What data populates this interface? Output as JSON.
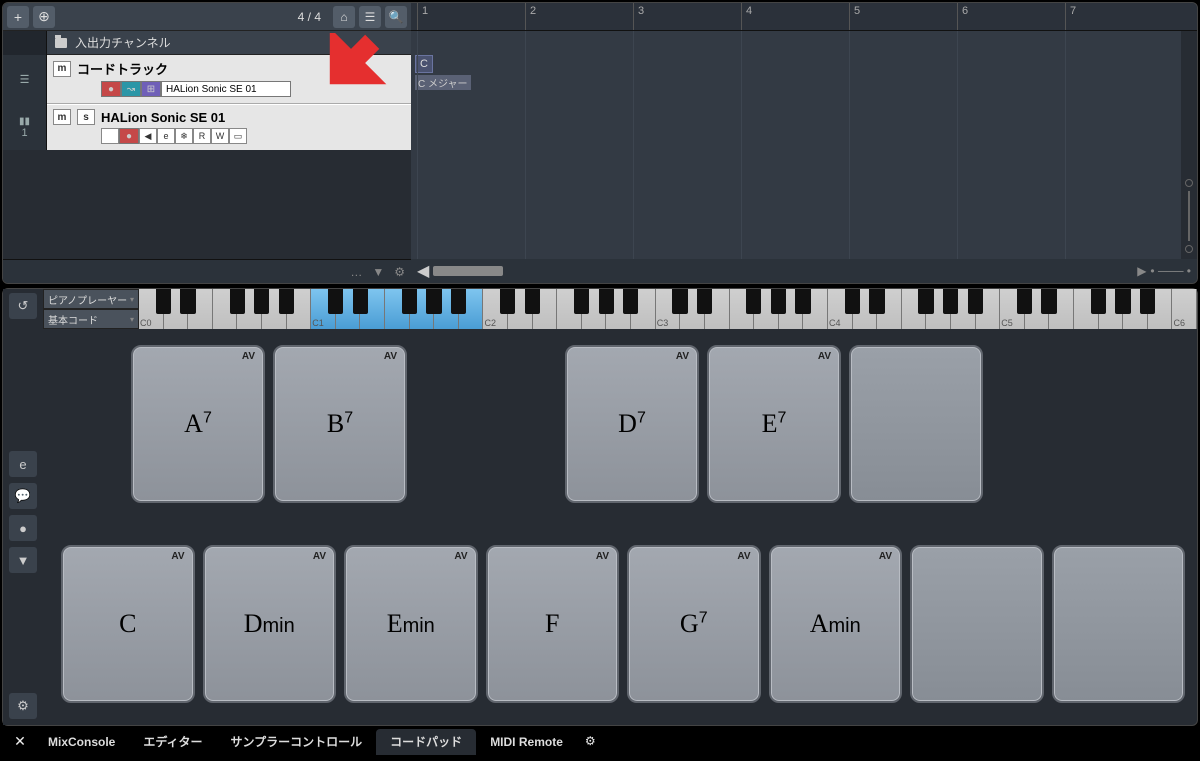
{
  "toolbar": {
    "time_sig": "4 / 4",
    "add_icon": "+",
    "config_icon": "⊕",
    "home_icon": "⌂",
    "list_icon": "☰",
    "search_icon": "🔍"
  },
  "tracks": {
    "bus_label": "入出力チャンネル",
    "chord_track": {
      "mute": "m",
      "name": "コードトラック",
      "instrument": "HALion Sonic SE 01"
    },
    "midi_track": {
      "num": "1",
      "mute": "m",
      "solo": "s",
      "name": "HALion Sonic SE 01",
      "ctrl_e": "e",
      "ctrl_r": "R",
      "ctrl_w": "W"
    }
  },
  "ruler": {
    "bars": [
      "1",
      "2",
      "3",
      "4",
      "5",
      "6",
      "7"
    ]
  },
  "clip": {
    "root": "C",
    "label": "C メジャー"
  },
  "chordpad": {
    "player_label": "ピアノプレーヤー",
    "basic_label": "基本コード",
    "octaves": [
      "C0",
      "C1",
      "C2",
      "C3",
      "C4",
      "C5",
      "C6"
    ],
    "av": "AV",
    "top": [
      "A|7",
      "B|7",
      "",
      "D|7",
      "E|7",
      ""
    ],
    "bot": [
      "C",
      "D|min",
      "E|min",
      "F",
      "G|7",
      "A|min",
      "",
      ""
    ]
  },
  "tabs": {
    "close": "✕",
    "items": [
      "MixConsole",
      "エディター",
      "サンプラーコントロール",
      "コードパッド",
      "MIDI Remote"
    ],
    "active_index": 3,
    "gear": "⚙"
  },
  "icons": {
    "undo": "↺",
    "edit": "e",
    "comment": "💬",
    "rec": "●",
    "down": "▼",
    "gear": "⚙",
    "left": "◀",
    "right": "▶",
    "dot": "…",
    "speaker": "◀"
  }
}
